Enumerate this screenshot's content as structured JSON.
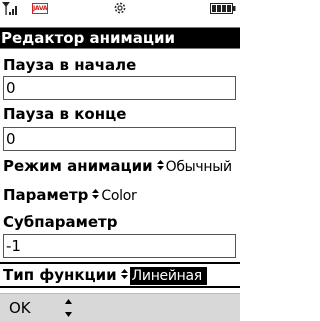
{
  "status": {
    "java_badge": "JAVA",
    "signal_icon": "signal-icon",
    "settings_icon": "gear-icon",
    "battery_icon": "battery-icon"
  },
  "form": {
    "title": "Редактор анимации",
    "pause_start": {
      "label": "Пауза в начале",
      "value": "0"
    },
    "pause_end": {
      "label": "Пауза в конце",
      "value": "0"
    },
    "anim_mode": {
      "label": "Режим анимации",
      "value": "Обычный"
    },
    "parameter": {
      "label": "Параметр",
      "value": "Color"
    },
    "subparameter": {
      "label": "Субпараметр",
      "value": "-1"
    },
    "func_type": {
      "label": "Тип функции",
      "value": "Линейная"
    }
  },
  "softkeys": {
    "left": "OK",
    "center_icon": "up-down-arrows-icon"
  }
}
